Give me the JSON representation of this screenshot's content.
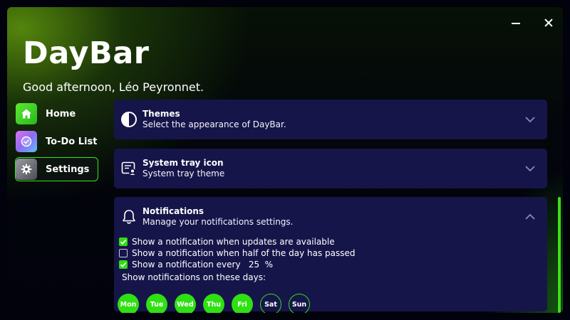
{
  "app": {
    "title": "DayBar",
    "greeting": "Good afternoon, Léo Peyronnet."
  },
  "window_controls": {
    "minimize": "minimize-icon",
    "close": "close-icon"
  },
  "nav": {
    "items": [
      {
        "label": "Home",
        "icon": "home-icon",
        "active": false
      },
      {
        "label": "To-Do List",
        "icon": "todo-icon",
        "active": false
      },
      {
        "label": "Settings",
        "icon": "gear-icon",
        "active": true
      }
    ]
  },
  "settings": {
    "themes": {
      "title": "Themes",
      "subtitle": "Select the appearance of DayBar.",
      "icon": "theme-contrast-icon",
      "expanded": false
    },
    "tray": {
      "title": "System tray icon",
      "subtitle": "System tray theme",
      "icon": "tray-settings-icon",
      "expanded": false
    },
    "notifications": {
      "title": "Notifications",
      "subtitle": "Manage your notifications settings.",
      "icon": "bell-icon",
      "expanded": true,
      "options": [
        {
          "label": "Show a notification when updates are available",
          "checked": true
        },
        {
          "label": "Show a notification when half of the day has passed",
          "checked": false
        },
        {
          "label": "Show a notification every",
          "checked": true
        }
      ],
      "interval_value": "25",
      "interval_unit": "%",
      "days_label": "Show notifications on these days:",
      "days": [
        {
          "label": "Mon",
          "on": true
        },
        {
          "label": "Tue",
          "on": true
        },
        {
          "label": "Wed",
          "on": true
        },
        {
          "label": "Thu",
          "on": true
        },
        {
          "label": "Fri",
          "on": true
        },
        {
          "label": "Sat",
          "on": false
        },
        {
          "label": "Sun",
          "on": false
        }
      ]
    }
  },
  "colors": {
    "accent": "#2fe012",
    "card": "#16154a",
    "background": "#02020c"
  }
}
